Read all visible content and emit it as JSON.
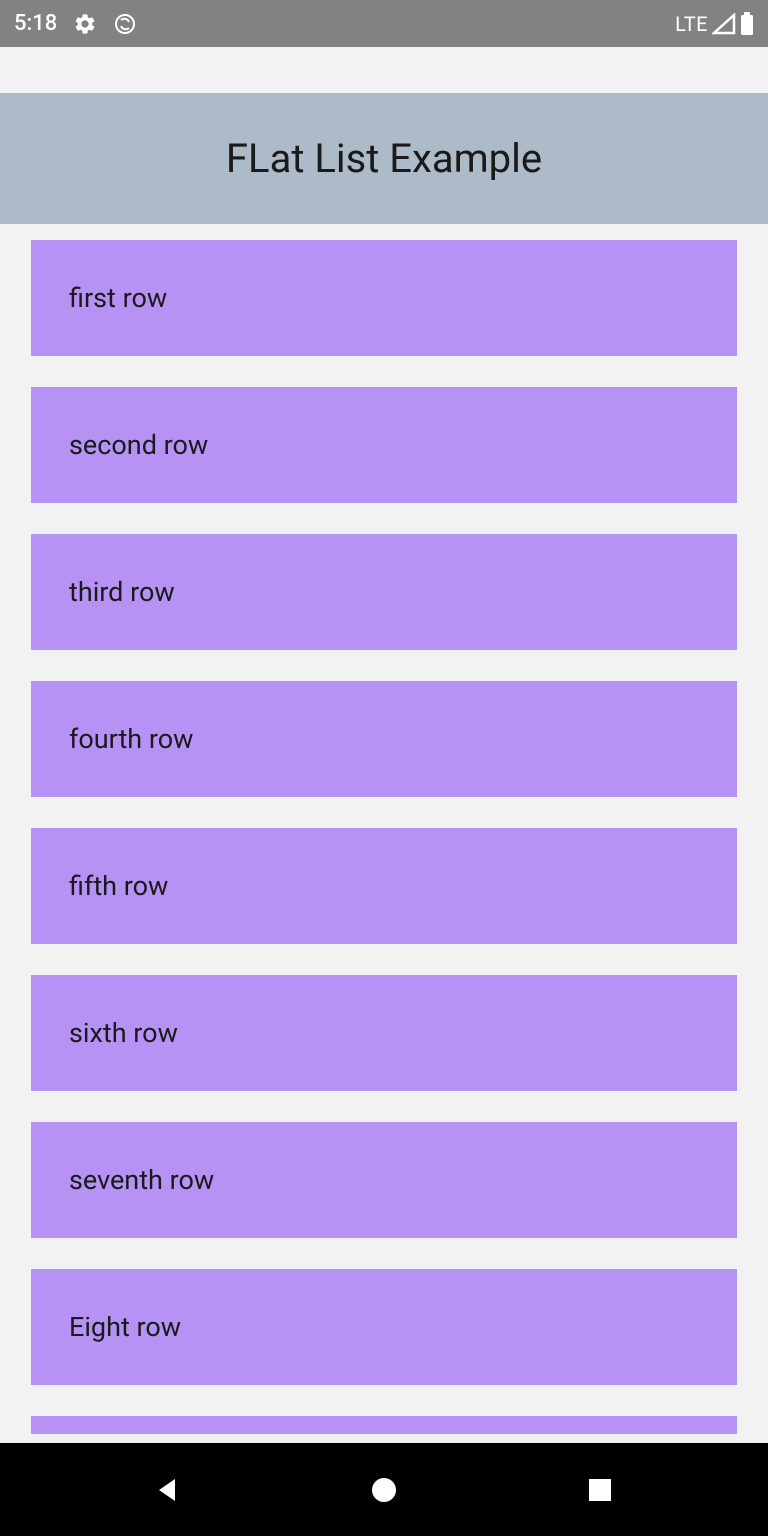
{
  "status_bar": {
    "time": "5:18",
    "network": "LTE"
  },
  "header": {
    "title": "FLat List Example"
  },
  "list": {
    "items": [
      {
        "label": "first row"
      },
      {
        "label": "second row"
      },
      {
        "label": "third row"
      },
      {
        "label": "fourth row"
      },
      {
        "label": "fifth row"
      },
      {
        "label": "sixth row"
      },
      {
        "label": "seventh row"
      },
      {
        "label": "Eight row"
      }
    ]
  },
  "colors": {
    "status_bar": "#828282",
    "header_bg": "#adbbc9",
    "item_bg": "#b692f5",
    "page_bg": "#f2f2f2"
  }
}
